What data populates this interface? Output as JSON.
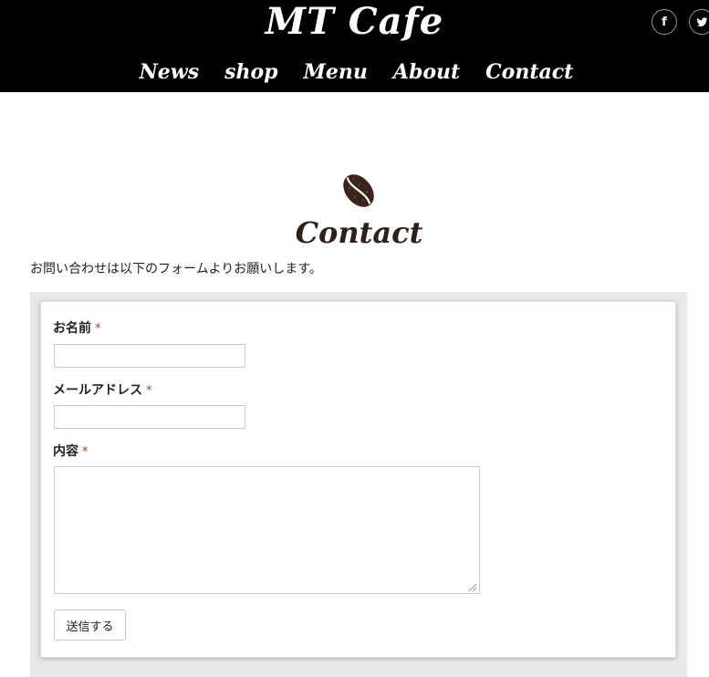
{
  "header": {
    "logo": "MT Cafe",
    "social": [
      {
        "name": "facebook",
        "glyph": "f"
      },
      {
        "name": "twitter",
        "glyph": ""
      }
    ],
    "nav": [
      "News",
      "shop",
      "Menu",
      "About",
      "Contact"
    ]
  },
  "section": {
    "icon": "coffee-bean-icon",
    "title": "Contact",
    "intro": "お問い合わせは以下のフォームよりお願いします。"
  },
  "form": {
    "name_label": "お名前",
    "email_label": "メールアドレス",
    "content_label": "内容",
    "required_mark": "*",
    "name_value": "",
    "email_value": "",
    "content_value": "",
    "submit_label": "送信する"
  },
  "colors": {
    "header_bg": "#000000",
    "title": "#2e201a",
    "required": "#c0392b",
    "form_bg": "#e9e9e9"
  }
}
